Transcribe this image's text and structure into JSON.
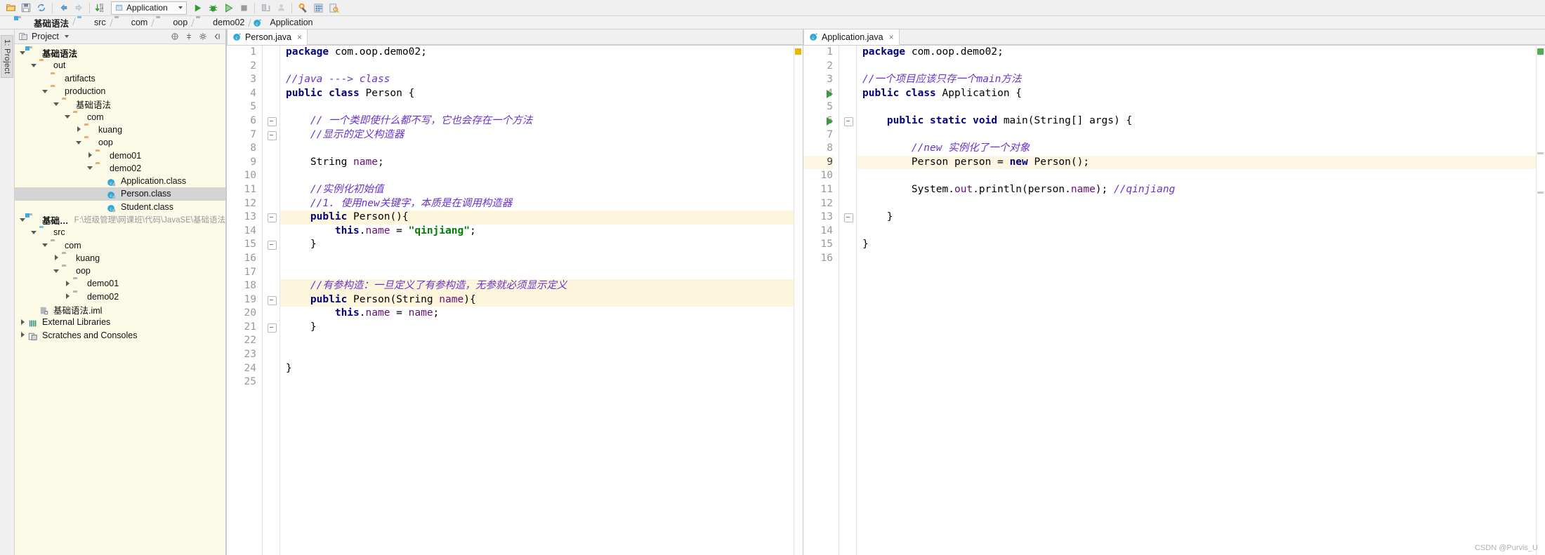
{
  "toolbar": {
    "icons": [
      "open-folder-icon",
      "save-icon",
      "sync-icon",
      "back-icon",
      "forward-icon",
      "sort-icon"
    ],
    "run_config": {
      "label": "Application",
      "icon": "run-config-icon"
    },
    "run_label": "Run",
    "debug_label": "Debug",
    "coverage_label": "Run with Coverage",
    "stop_label": "Stop",
    "actions": [
      "run-icon",
      "debug-icon",
      "coverage-icon",
      "stop-icon",
      "update-app-icon",
      "profile-icon",
      "settings-icon",
      "structure-icon",
      "search-icon"
    ]
  },
  "breadcrumb": [
    {
      "label": "基础语法",
      "icon": "module-icon",
      "bold": true
    },
    {
      "label": "src",
      "icon": "source-folder-icon",
      "bold": false
    },
    {
      "label": "com",
      "icon": "package-icon",
      "bold": false
    },
    {
      "label": "oop",
      "icon": "package-icon",
      "bold": false
    },
    {
      "label": "demo02",
      "icon": "package-icon",
      "bold": false
    },
    {
      "label": "Application",
      "icon": "java-class-icon",
      "bold": false
    }
  ],
  "left_rail": {
    "project_tab": "1: Project"
  },
  "project_panel": {
    "title": "Project",
    "header_icons": [
      "collapse-all-icon",
      "locate-icon",
      "settings-gear-icon",
      "hide-icon"
    ],
    "tree": [
      {
        "label": "基础语法",
        "depth": 0,
        "arrow": "down",
        "icon": "module-icon",
        "bold": true,
        "selected": false,
        "path": ""
      },
      {
        "label": "out",
        "depth": 1,
        "arrow": "down",
        "icon": "folder-orange",
        "bold": false,
        "selected": false,
        "path": ""
      },
      {
        "label": "artifacts",
        "depth": 2,
        "arrow": "none",
        "icon": "folder-orange",
        "bold": false,
        "selected": false,
        "path": ""
      },
      {
        "label": "production",
        "depth": 2,
        "arrow": "down",
        "icon": "folder-orange",
        "bold": false,
        "selected": false,
        "path": ""
      },
      {
        "label": "基础语法",
        "depth": 3,
        "arrow": "down",
        "icon": "folder-orange",
        "bold": false,
        "selected": false,
        "path": ""
      },
      {
        "label": "com",
        "depth": 4,
        "arrow": "down",
        "icon": "folder-orange",
        "bold": false,
        "selected": false,
        "path": ""
      },
      {
        "label": "kuang",
        "depth": 5,
        "arrow": "right",
        "icon": "folder-orange",
        "bold": false,
        "selected": false,
        "path": ""
      },
      {
        "label": "oop",
        "depth": 5,
        "arrow": "down",
        "icon": "folder-orange",
        "bold": false,
        "selected": false,
        "path": ""
      },
      {
        "label": "demo01",
        "depth": 6,
        "arrow": "right",
        "icon": "folder-orange",
        "bold": false,
        "selected": false,
        "path": ""
      },
      {
        "label": "demo02",
        "depth": 6,
        "arrow": "down",
        "icon": "folder-orange",
        "bold": false,
        "selected": false,
        "path": ""
      },
      {
        "label": "Application.class",
        "depth": 7,
        "arrow": "none",
        "icon": "class-file-icon",
        "bold": false,
        "selected": false,
        "path": ""
      },
      {
        "label": "Person.class",
        "depth": 7,
        "arrow": "none",
        "icon": "class-file-icon",
        "bold": false,
        "selected": true,
        "path": ""
      },
      {
        "label": "Student.class",
        "depth": 7,
        "arrow": "none",
        "icon": "class-file-icon",
        "bold": false,
        "selected": false,
        "path": ""
      },
      {
        "label": "基础语法",
        "depth": 0,
        "arrow": "down",
        "icon": "module-icon",
        "bold": true,
        "selected": false,
        "path": "F:\\班级管理\\网课班\\代码\\JavaSE\\基础语法"
      },
      {
        "label": "src",
        "depth": 1,
        "arrow": "down",
        "icon": "folder-blue",
        "bold": false,
        "selected": false,
        "path": ""
      },
      {
        "label": "com",
        "depth": 2,
        "arrow": "down",
        "icon": "folder-gray",
        "bold": false,
        "selected": false,
        "path": ""
      },
      {
        "label": "kuang",
        "depth": 3,
        "arrow": "right",
        "icon": "folder-gray",
        "bold": false,
        "selected": false,
        "path": ""
      },
      {
        "label": "oop",
        "depth": 3,
        "arrow": "down",
        "icon": "folder-gray",
        "bold": false,
        "selected": false,
        "path": ""
      },
      {
        "label": "demo01",
        "depth": 4,
        "arrow": "right",
        "icon": "folder-gray",
        "bold": false,
        "selected": false,
        "path": ""
      },
      {
        "label": "demo02",
        "depth": 4,
        "arrow": "right",
        "icon": "folder-gray",
        "bold": false,
        "selected": false,
        "path": ""
      },
      {
        "label": "基础语法.iml",
        "depth": 1,
        "arrow": "none",
        "icon": "iml-file-icon",
        "bold": false,
        "selected": false,
        "path": ""
      },
      {
        "label": "External Libraries",
        "depth": 0,
        "arrow": "right",
        "icon": "libraries-icon",
        "bold": false,
        "selected": false,
        "path": ""
      },
      {
        "label": "Scratches and Consoles",
        "depth": 0,
        "arrow": "right",
        "icon": "scratches-icon",
        "bold": false,
        "selected": false,
        "path": ""
      }
    ]
  },
  "editor_left": {
    "tab": {
      "label": "Person.java",
      "icon": "java-class-icon",
      "close": "×"
    },
    "lines": [
      {
        "n": 1,
        "text": "package com.oop.demo02;",
        "type": "code"
      },
      {
        "n": 2,
        "text": "",
        "type": "blank"
      },
      {
        "n": 3,
        "text": "//java ---> class",
        "type": "comment"
      },
      {
        "n": 4,
        "text": "public class Person {",
        "type": "code"
      },
      {
        "n": 5,
        "text": "",
        "type": "blank"
      },
      {
        "n": 6,
        "text": "    // 一个类即使什么都不写，它也会存在一个方法",
        "type": "comment"
      },
      {
        "n": 7,
        "text": "    //显示的定义构造器",
        "type": "comment"
      },
      {
        "n": 8,
        "text": "",
        "type": "blank"
      },
      {
        "n": 9,
        "text": "    String name;",
        "type": "code"
      },
      {
        "n": 10,
        "text": "",
        "type": "blank"
      },
      {
        "n": 11,
        "text": "    //实例化初始值",
        "type": "comment"
      },
      {
        "n": 12,
        "text": "    //1. 使用new关键字，本质是在调用构造器",
        "type": "comment"
      },
      {
        "n": 13,
        "text": "    public Person(){",
        "type": "code"
      },
      {
        "n": 14,
        "text": "        this.name = \"qinjiang\";",
        "type": "code"
      },
      {
        "n": 15,
        "text": "    }",
        "type": "code"
      },
      {
        "n": 16,
        "text": "",
        "type": "blank"
      },
      {
        "n": 17,
        "text": "",
        "type": "blank"
      },
      {
        "n": 18,
        "text": "    //有参构造：一旦定义了有参构造，无参就必须显示定义",
        "type": "comment"
      },
      {
        "n": 19,
        "text": "    public Person(String name){",
        "type": "code"
      },
      {
        "n": 20,
        "text": "        this.name = name;",
        "type": "code"
      },
      {
        "n": 21,
        "text": "    }",
        "type": "code"
      },
      {
        "n": 22,
        "text": "",
        "type": "blank"
      },
      {
        "n": 23,
        "text": "",
        "type": "blank"
      },
      {
        "n": 24,
        "text": "}",
        "type": "code"
      },
      {
        "n": 25,
        "text": "",
        "type": "blank"
      }
    ]
  },
  "editor_right": {
    "tab": {
      "label": "Application.java",
      "icon": "java-class-icon",
      "close": "×"
    },
    "lines": [
      {
        "n": 1,
        "text": "package com.oop.demo02;",
        "type": "code"
      },
      {
        "n": 2,
        "text": "",
        "type": "blank"
      },
      {
        "n": 3,
        "text": "//一个项目应该只存一个main方法",
        "type": "comment"
      },
      {
        "n": 4,
        "text": "public class Application {",
        "type": "code"
      },
      {
        "n": 5,
        "text": "",
        "type": "blank"
      },
      {
        "n": 6,
        "text": "    public static void main(String[] args) {",
        "type": "code"
      },
      {
        "n": 7,
        "text": "",
        "type": "blank"
      },
      {
        "n": 8,
        "text": "        //new 实例化了一个对象",
        "type": "comment"
      },
      {
        "n": 9,
        "text": "        Person person = new Person();",
        "type": "code"
      },
      {
        "n": 10,
        "text": "",
        "type": "blank"
      },
      {
        "n": 11,
        "text": "        System.out.println(person.name); //qinjiang",
        "type": "code"
      },
      {
        "n": 12,
        "text": "",
        "type": "blank"
      },
      {
        "n": 13,
        "text": "    }",
        "type": "code"
      },
      {
        "n": 14,
        "text": "",
        "type": "blank"
      },
      {
        "n": 15,
        "text": "}",
        "type": "code"
      },
      {
        "n": 16,
        "text": "",
        "type": "blank"
      }
    ]
  },
  "watermark": "CSDN @Purvis_U",
  "colors": {
    "comment": "#6a31ce",
    "keyword": "#000080",
    "string": "#008000",
    "field": "#660e7a",
    "selection": "#d4d4d4",
    "panel_bg": "#fbfbe8",
    "warning_marker": "#e6b800"
  }
}
